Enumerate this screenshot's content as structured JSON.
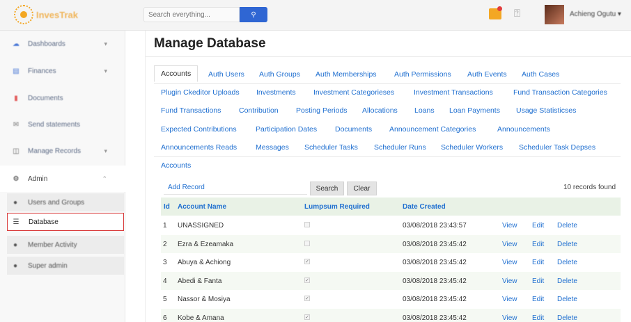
{
  "app": {
    "logo_text": "InvesTrak"
  },
  "header": {
    "search_placeholder": "Search everything...",
    "user_name": "Achieng Ogutu ▾"
  },
  "sidebar": {
    "items": [
      {
        "label": "Dashboards",
        "icon": "cloud-icon",
        "chevron": "▾"
      },
      {
        "label": "Finances",
        "icon": "money-icon",
        "chevron": "▾"
      },
      {
        "label": "Documents",
        "icon": "document-icon",
        "chevron": ""
      },
      {
        "label": "Send statements",
        "icon": "send-icon",
        "chevron": ""
      },
      {
        "label": "Manage Records",
        "icon": "records-icon",
        "chevron": "▾"
      },
      {
        "label": "Admin",
        "icon": "gears-icon",
        "chevron": "⌃"
      }
    ],
    "admin_sub": [
      {
        "label": "Users and Groups",
        "icon": "users-icon"
      },
      {
        "label": "Database",
        "icon": "database-icon"
      },
      {
        "label": "Member Activity",
        "icon": "activity-icon"
      },
      {
        "label": "Super admin",
        "icon": "superadmin-icon"
      }
    ]
  },
  "page": {
    "title": "Manage Database"
  },
  "tabs": [
    "Accounts",
    "Auth Users",
    "Auth Groups",
    "Auth Memberships",
    "Auth Permissions",
    "Auth Events",
    "Auth Cases",
    "Plugin Ckeditor Uploads",
    "Investments",
    "Investment Categorieses",
    "Investment Transactions",
    "Fund Transaction Categories",
    "Fund Transactions",
    "Contribution",
    "Posting Periods",
    "Allocations",
    "Loans",
    "Loan Payments",
    "Usage Statisticses",
    "Expected Contributions",
    "Participation Dates",
    "Documents",
    "Announcement Categories",
    "Announcements",
    "Announcements Reads",
    "Messages",
    "Scheduler Tasks",
    "Scheduler Runs",
    "Scheduler Workers",
    "Scheduler Task Depses",
    "Accounts"
  ],
  "toolbar": {
    "add_record": "Add Record",
    "search_label": "Search",
    "clear_label": "Clear",
    "records_found": "10 records found"
  },
  "table": {
    "headers": [
      "Id",
      "Account Name",
      "Lumpsum Required",
      "Date Created"
    ],
    "rows": [
      {
        "id": "1",
        "name": "UNASSIGNED",
        "lumpsum": false,
        "date": "03/08/2018 23:43:57",
        "view": "View",
        "edit": "Edit",
        "delete": "Delete"
      },
      {
        "id": "2",
        "name": "Ezra & Ezeamaka",
        "lumpsum": false,
        "date": "03/08/2018 23:45:42",
        "view": "View",
        "edit": "Edit",
        "delete": "Delete"
      },
      {
        "id": "3",
        "name": "Abuya & Achiong",
        "lumpsum": true,
        "date": "03/08/2018 23:45:42",
        "view": "View",
        "edit": "Edit",
        "delete": "Delete"
      },
      {
        "id": "4",
        "name": "Abedi & Fanta",
        "lumpsum": true,
        "date": "03/08/2018 23:45:42",
        "view": "View",
        "edit": "Edit",
        "delete": "Delete"
      },
      {
        "id": "5",
        "name": "Nassor & Mosiya",
        "lumpsum": true,
        "date": "03/08/2018 23:45:42",
        "view": "View",
        "edit": "Edit",
        "delete": "Delete"
      },
      {
        "id": "6",
        "name": "Kobe & Amana",
        "lumpsum": true,
        "date": "03/08/2018 23:45:42",
        "view": "View",
        "edit": "Edit",
        "delete": "Delete"
      }
    ]
  },
  "colors": {
    "accent": "#2f66d3",
    "link": "#1f6fd0",
    "active_border": "#d93c3c",
    "header_row": "#e9f2e6"
  }
}
